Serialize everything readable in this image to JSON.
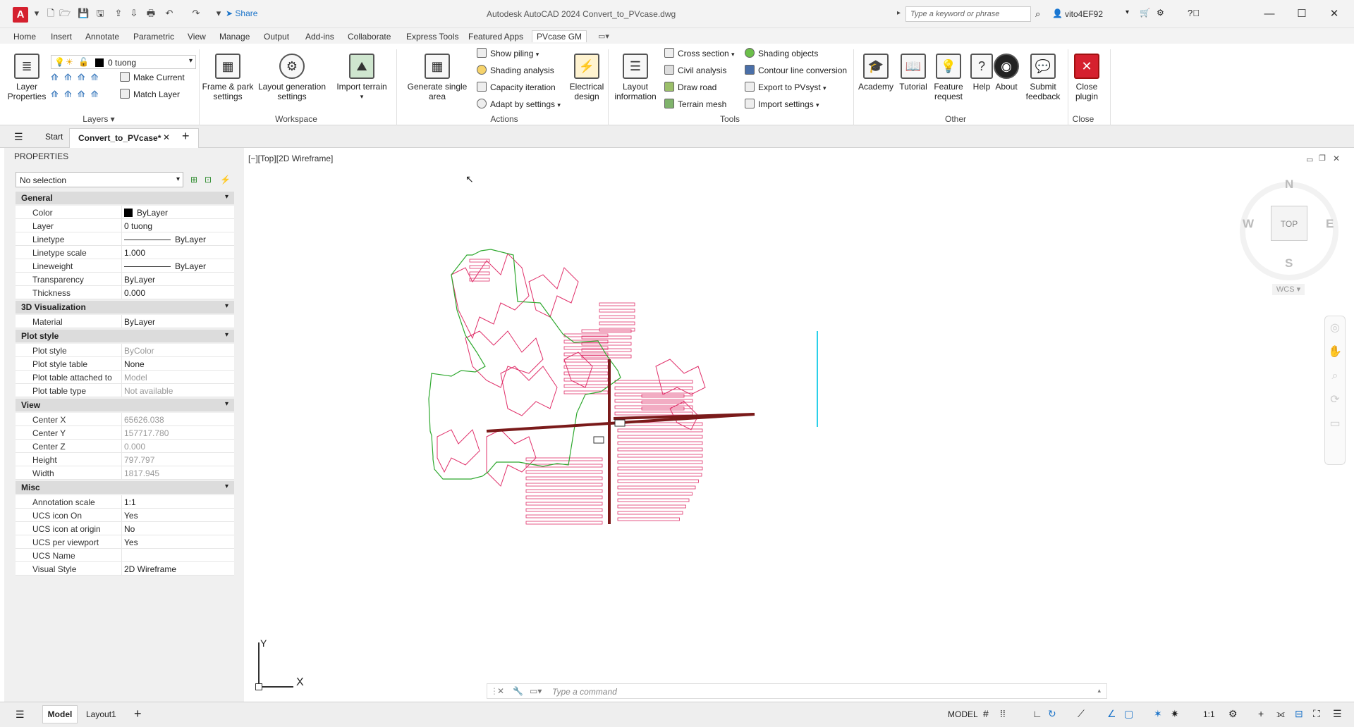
{
  "title_bar": {
    "share_label": "Share",
    "window_title": "Autodesk AutoCAD 2024   Convert_to_PVcase.dwg",
    "search_placeholder": "Type a keyword or phrase",
    "user_name": "vito4EF92"
  },
  "menu_tabs": [
    "Home",
    "Insert",
    "Annotate",
    "Parametric",
    "View",
    "Manage",
    "Output",
    "Add-ins",
    "Collaborate",
    "Express Tools",
    "Featured Apps",
    "PVcase GM"
  ],
  "ribbon": {
    "layers": {
      "layer_properties": "Layer\nProperties",
      "current_layer": "0 tuong",
      "make_current": "Make Current",
      "match_layer": "Match Layer",
      "panel_title": "Layers"
    },
    "workspace": {
      "frame_park": "Frame & park\nsettings",
      "layout_generation": "Layout generation\nsettings",
      "import_terrain": "Import terrain",
      "panel_title": "Workspace"
    },
    "actions": {
      "generate_single_area": "Generate single\narea",
      "show_piling": "Show piling",
      "shading_analysis": "Shading analysis",
      "capacity_iteration": "Capacity iteration",
      "adapt_by_settings": "Adapt by settings",
      "electrical_design": "Electrical\ndesign",
      "panel_title": "Actions"
    },
    "tools": {
      "layout_information": "Layout\ninformation",
      "cross_section": "Cross section",
      "civil_analysis": "Civil analysis",
      "draw_road": "Draw road",
      "terrain_mesh": "Terrain mesh",
      "shading_objects": "Shading objects",
      "contour_line_conversion": "Contour line conversion",
      "export_pvsyst": "Export to PVsyst",
      "import_settings": "Import settings",
      "panel_title": "Tools"
    },
    "other": {
      "academy": "Academy",
      "tutorial": "Tutorial",
      "feature_request": "Feature\nrequest",
      "help": "Help",
      "about": "About",
      "submit_feedback": "Submit\nfeedback",
      "panel_title": "Other"
    },
    "close": {
      "close_plugin": "Close\nplugin",
      "panel_title": "Close"
    }
  },
  "doc_tabs": {
    "start": "Start",
    "active": "Convert_to_PVcase*"
  },
  "properties": {
    "title": "PROPERTIES",
    "selection": "No selection",
    "groups": [
      {
        "name": "General",
        "rows": [
          {
            "name": "Color",
            "value": "ByLayer"
          },
          {
            "name": "Layer",
            "value": "0 tuong"
          },
          {
            "name": "Linetype",
            "value": "ByLayer"
          },
          {
            "name": "Linetype scale",
            "value": "1.000"
          },
          {
            "name": "Lineweight",
            "value": "ByLayer"
          },
          {
            "name": "Transparency",
            "value": "ByLayer"
          },
          {
            "name": "Thickness",
            "value": "0.000"
          }
        ]
      },
      {
        "name": "3D Visualization",
        "rows": [
          {
            "name": "Material",
            "value": "ByLayer"
          }
        ]
      },
      {
        "name": "Plot style",
        "rows": [
          {
            "name": "Plot style",
            "value": "ByColor"
          },
          {
            "name": "Plot style table",
            "value": "None"
          },
          {
            "name": "Plot table attached to",
            "value": "Model"
          },
          {
            "name": "Plot table type",
            "value": "Not available"
          }
        ]
      },
      {
        "name": "View",
        "rows": [
          {
            "name": "Center X",
            "value": "65626.038"
          },
          {
            "name": "Center Y",
            "value": "157717.780"
          },
          {
            "name": "Center Z",
            "value": "0.000"
          },
          {
            "name": "Height",
            "value": "797.797"
          },
          {
            "name": "Width",
            "value": "1817.945"
          }
        ]
      },
      {
        "name": "Misc",
        "rows": [
          {
            "name": "Annotation scale",
            "value": "1:1"
          },
          {
            "name": "UCS icon On",
            "value": "Yes"
          },
          {
            "name": "UCS icon at origin",
            "value": "No"
          },
          {
            "name": "UCS per viewport",
            "value": "Yes"
          },
          {
            "name": "UCS Name",
            "value": ""
          },
          {
            "name": "Visual Style",
            "value": "2D Wireframe"
          }
        ]
      }
    ]
  },
  "viewport": {
    "label": "[−][Top][2D Wireframe]",
    "viewcube": {
      "n": "N",
      "s": "S",
      "e": "E",
      "w": "W",
      "face": "TOP",
      "wcs": "WCS"
    },
    "ucs_x": "X",
    "ucs_y": "Y"
  },
  "command_line": {
    "placeholder": "Type a command"
  },
  "status_bar": {
    "model_tab": "Model",
    "layout_tab": "Layout1",
    "model_label": "MODEL",
    "scale": "1:1"
  },
  "colors": {
    "accent": "#d5202e",
    "boundary": "#2ea82e",
    "rows": "#e0306a",
    "road": "#7a1a1a"
  }
}
